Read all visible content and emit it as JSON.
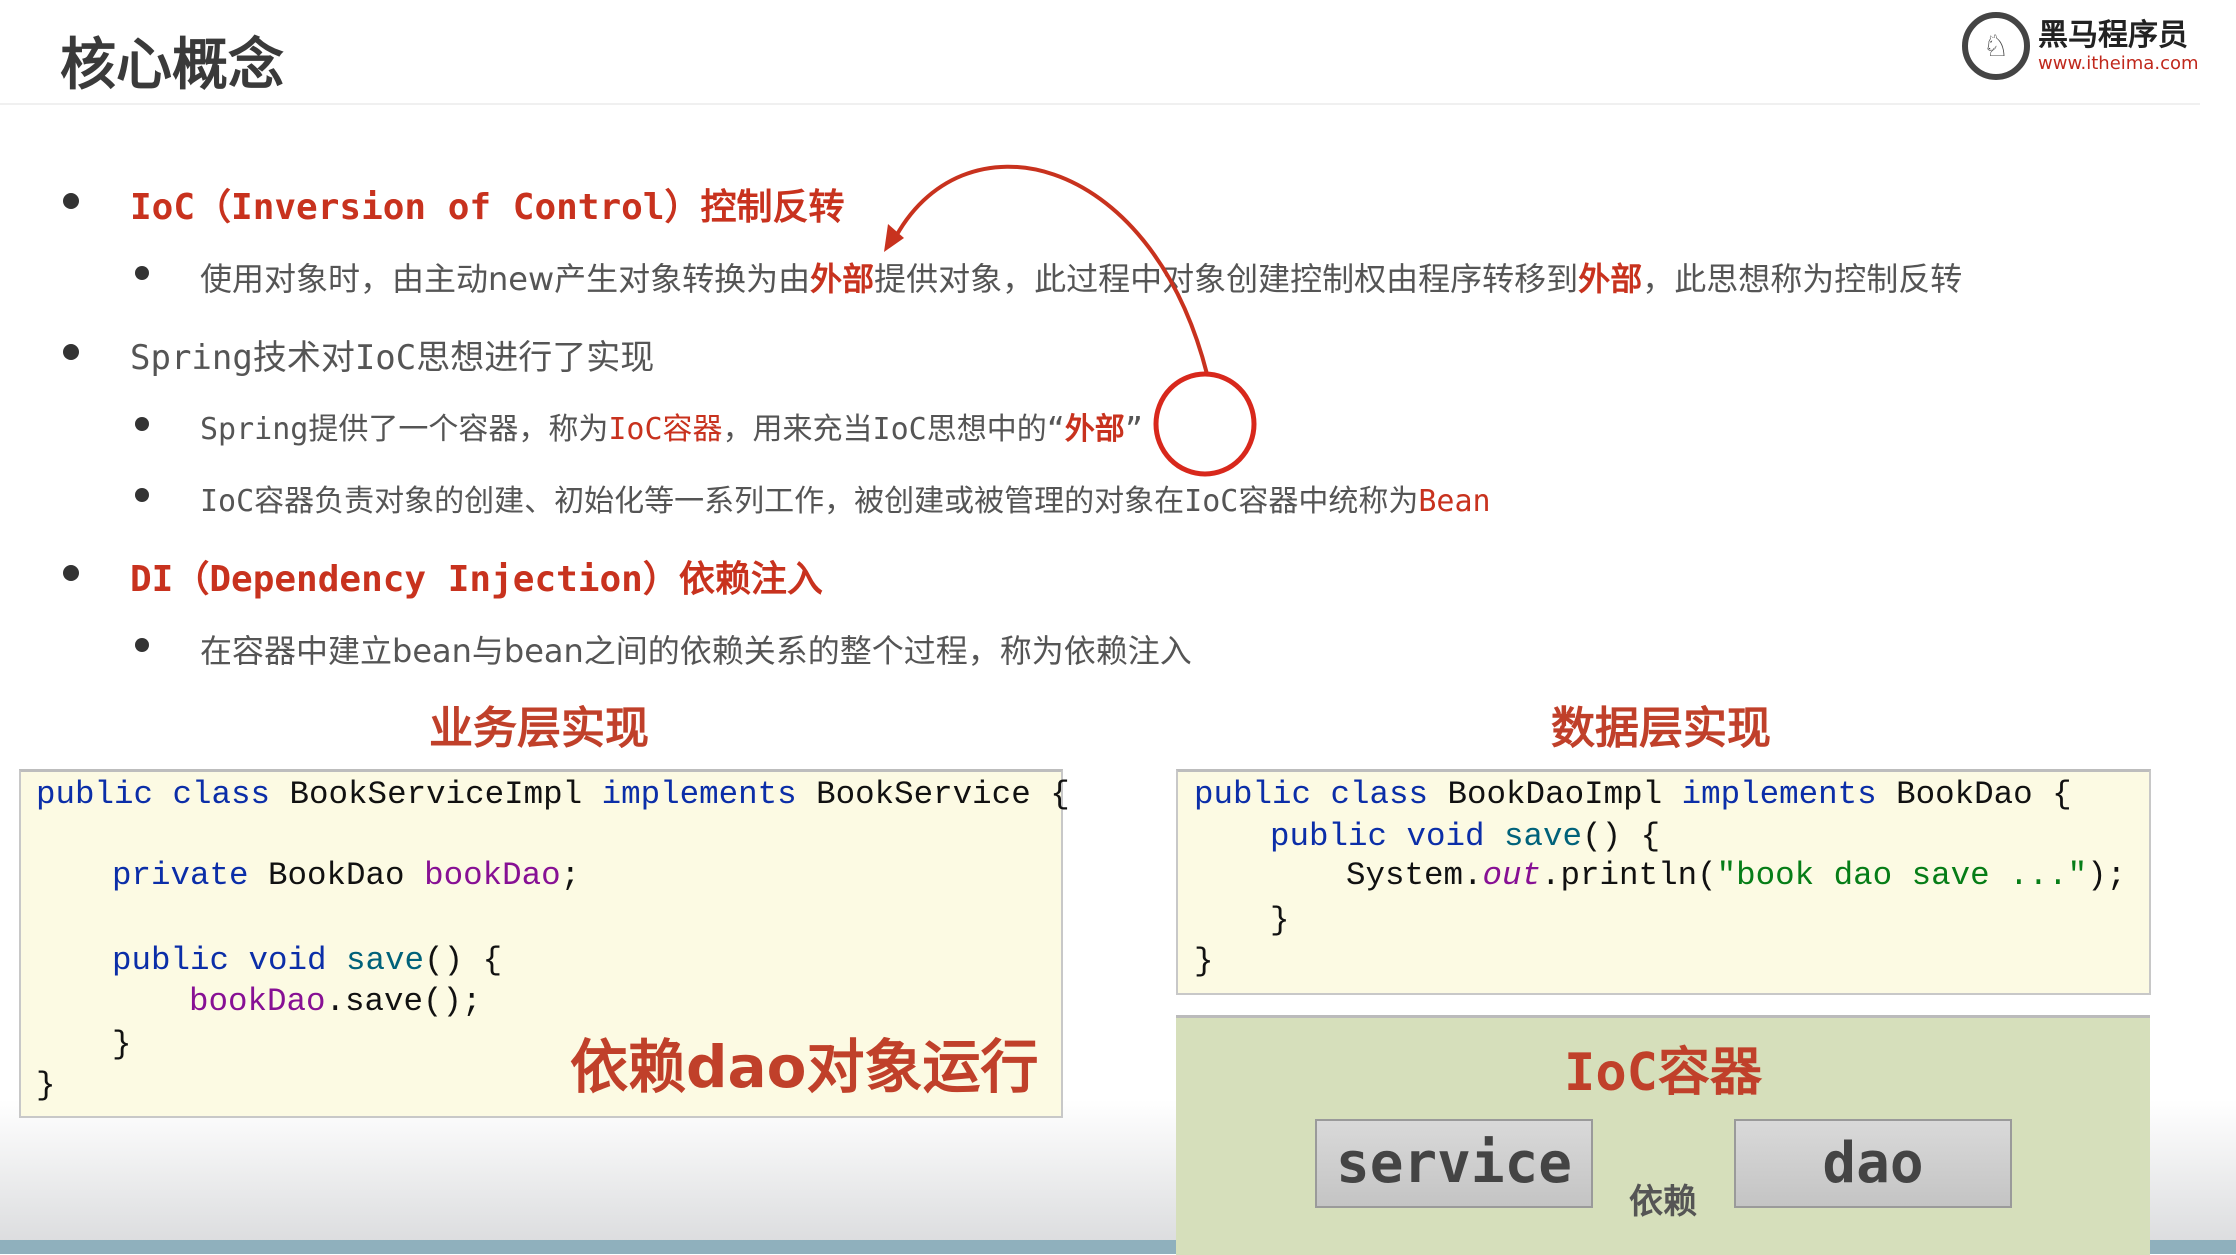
{
  "header": {
    "title": "核心概念",
    "logo_name": "黑马程序员",
    "logo_url": "www.itheima.com"
  },
  "bullets": {
    "ioc_title_a": "IoC（Inversion of Control）",
    "ioc_title_b": "控制反转",
    "ioc_sub_a": "使用对象时，由主动new产生对象转换为由",
    "ioc_sub_b": "外部",
    "ioc_sub_c": "提供对象，此过程中对象创建控制权由程序转移到",
    "ioc_sub_d": "外部",
    "ioc_sub_e": "，此思想称为控制反转",
    "spring": "Spring技术对IoC思想进行了实现",
    "spring_sub1_a": "Spring提供了一个容器，称为",
    "spring_sub1_b": "IoC容器",
    "spring_sub1_c": "，用来充当IoC思想中的“",
    "spring_sub1_d": "外部",
    "spring_sub1_e": "”",
    "spring_sub2_a": "IoC容器负责对象的创建、初始化等一系列工作，被创建或被管理的对象在IoC容器中统称为",
    "spring_sub2_b": "Bean",
    "di_title_a": "DI（Dependency Injection）",
    "di_title_b": "依赖注入",
    "di_sub": "在容器中建立bean与bean之间的依赖关系的整个过程，称为依赖注入"
  },
  "service_section": {
    "heading": "业务层实现",
    "annotation": "依赖dao对象运行",
    "code": {
      "l1_kw": "public class ",
      "l1_a": "BookServiceImpl ",
      "l1_kw2": "implements ",
      "l1_b": "BookService {",
      "l2_kw": "private ",
      "l2_a": "BookDao ",
      "l2_fd": "bookDao",
      "l2_b": ";",
      "l3_kw": "public void ",
      "l3_mt": "save",
      "l3_b": "() {",
      "l4_fd": "bookDao",
      "l4_b": ".save();",
      "l5": "}",
      "l6": "}"
    }
  },
  "dao_section": {
    "heading": "数据层实现",
    "code": {
      "l1_kw": "public class ",
      "l1_a": "BookDaoImpl ",
      "l1_kw2": "implements ",
      "l1_b": "BookDao {",
      "l2_kw": "public void ",
      "l2_mt": "save",
      "l2_b": "() {",
      "l3_a": "System.",
      "l3_it": "out",
      "l3_b": ".println(",
      "l3_st": "\"book dao save ...\"",
      "l3_c": ");",
      "l4": "}",
      "l5": "}"
    }
  },
  "ioc_container": {
    "title": "IoC容器",
    "service": "service",
    "dao": "dao",
    "relation": "依赖"
  },
  "colors": {
    "accent": "#c8321e",
    "code_bg": "#fcfae3",
    "container_bg": "#d6dfbb"
  }
}
